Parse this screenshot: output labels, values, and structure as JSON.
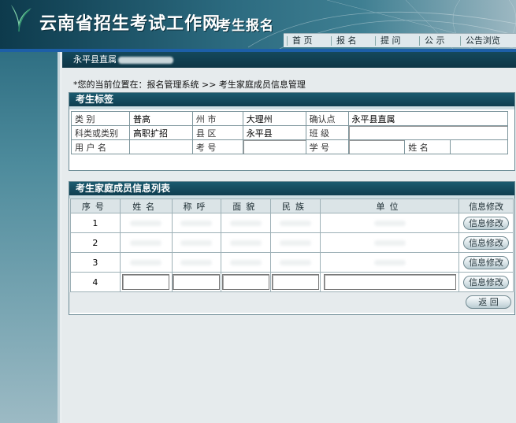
{
  "header": {
    "site_title": "云南省招生考试工作网",
    "sub_title": "考生报名",
    "nav": [
      "首 页",
      "报 名",
      "提 问",
      "公 示",
      "公告浏览"
    ]
  },
  "topbar": {
    "region": "永平县直属"
  },
  "breadcrumb": "*您的当前位置在：报名管理系统 >> 考生家庭成员信息管理",
  "tag_panel": {
    "title": "考生标签",
    "labels": {
      "category": "类    别",
      "prefecture": "州    市",
      "confirm_point": "确认点",
      "subject": "科类或类别",
      "county": "县    区",
      "class": "班    级",
      "username": "用 户 名",
      "exam_no": "考    号",
      "student_no": "学    号",
      "name": "姓    名"
    },
    "values": {
      "category": "普高",
      "prefecture": "大理州",
      "confirm_point": "永平县直属",
      "subject": "高职扩招",
      "county": "永平县",
      "username": "",
      "name": ""
    }
  },
  "family_panel": {
    "title": "考生家庭成员信息列表",
    "columns": [
      "序号",
      "姓名",
      "称呼",
      "面貌",
      "民族",
      "单位",
      "信息修改"
    ],
    "rows": [
      {
        "no": "1",
        "edit": "信息修改"
      },
      {
        "no": "2",
        "edit": "信息修改"
      },
      {
        "no": "3",
        "edit": "信息修改"
      },
      {
        "no": "4",
        "edit": "信息修改"
      }
    ],
    "back_label": "返    回"
  },
  "colors": {
    "header": "#1d5a6e",
    "accent_line": "#1d5fa8",
    "panel_head": "#14485b"
  }
}
